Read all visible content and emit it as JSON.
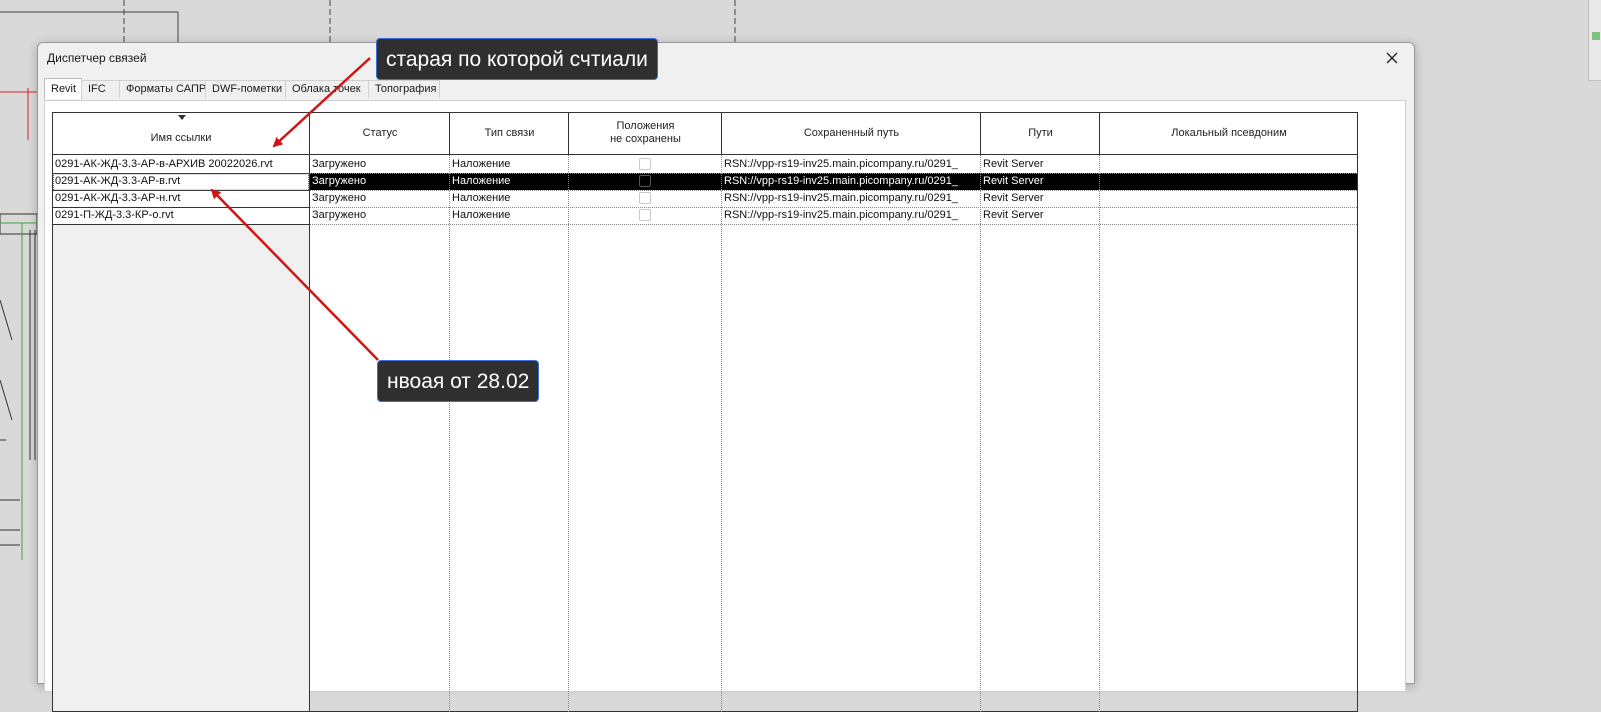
{
  "dialog": {
    "title": "Диспетчер связей",
    "tabs": [
      "Revit",
      "IFC",
      "Форматы САПР",
      "DWF-пометки",
      "Облака точек",
      "Топография"
    ],
    "active_tab": "Revit"
  },
  "table": {
    "columns": {
      "name": "Имя ссылки",
      "status": "Статус",
      "type": "Тип связи",
      "positions_line1": "Положения",
      "positions_line2": "не сохранены",
      "saved_path": "Сохраненный путь",
      "paths": "Пути",
      "alias": "Локальный псевдоним"
    },
    "rows": [
      {
        "name": "0291-АК-ЖД-3.3-АР-в-АРХИВ 20022026.rvt",
        "status": "Загружено",
        "type": "Наложение",
        "positions_not_saved": false,
        "saved_path": "RSN://vpp-rs19-inv25.main.picompany.ru/0291_",
        "paths": "Revit Server",
        "alias": ""
      },
      {
        "name": "0291-АК-ЖД-3.3-АР-в.rvt",
        "status": "Загружено",
        "type": "Наложение",
        "positions_not_saved": false,
        "saved_path": "RSN://vpp-rs19-inv25.main.picompany.ru/0291_",
        "paths": "Revit Server",
        "alias": "",
        "selected": true
      },
      {
        "name": "0291-АК-ЖД-3.3-АР-н.rvt",
        "status": "Загружено",
        "type": "Наложение",
        "positions_not_saved": false,
        "saved_path": "RSN://vpp-rs19-inv25.main.picompany.ru/0291_",
        "paths": "Revit Server",
        "alias": ""
      },
      {
        "name": "0291-П-ЖД-3.3-КР-о.rvt",
        "status": "Загружено",
        "type": "Наложение",
        "positions_not_saved": false,
        "saved_path": "RSN://vpp-rs19-inv25.main.picompany.ru/0291_",
        "paths": "Revit Server",
        "alias": ""
      }
    ]
  },
  "annotations": {
    "old": "старая по которой счтиали",
    "new": "нвоая от 28.02"
  },
  "colors": {
    "arrow": "#d11515",
    "callout_bg": "#2f2f2f",
    "callout_border": "#3b6fd6",
    "selected_row": "#000000"
  },
  "icons": {
    "close": "close-icon",
    "sort": "sort-down-icon"
  }
}
